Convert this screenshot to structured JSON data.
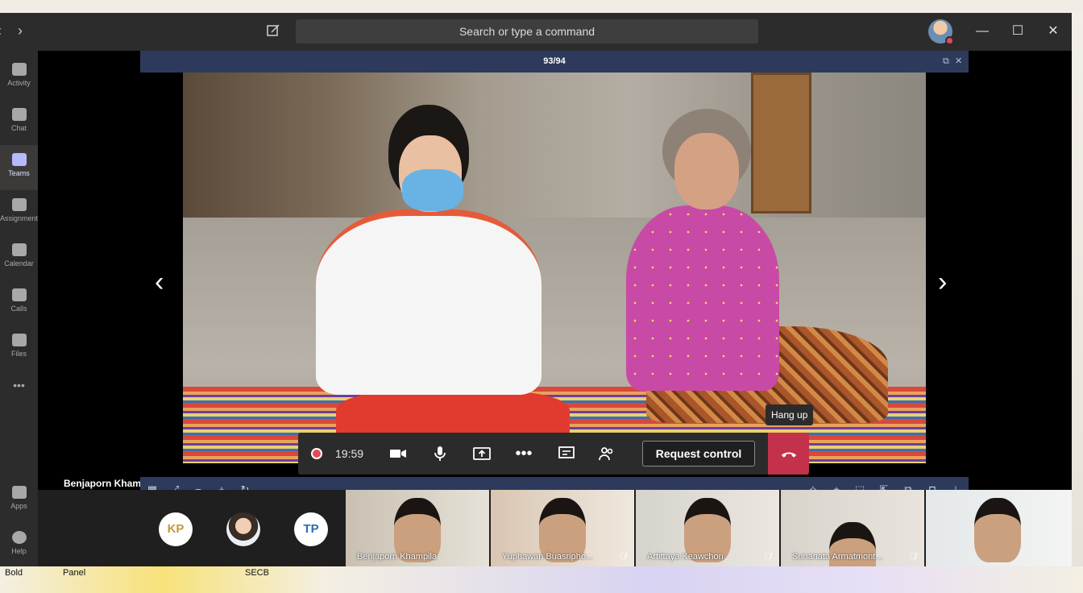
{
  "window": {
    "search_placeholder": "Search or type a command",
    "nav_back": "‹",
    "nav_forward": "›",
    "minimize": "—",
    "maximize": "☐",
    "close": "✕"
  },
  "rail": {
    "items": [
      {
        "label": "Activity"
      },
      {
        "label": "Chat"
      },
      {
        "label": "Teams"
      },
      {
        "label": "Assignments"
      },
      {
        "label": "Calendar"
      },
      {
        "label": "Calls"
      },
      {
        "label": "Files"
      },
      {
        "label": "•••"
      },
      {
        "label": "Apps"
      },
      {
        "label": "Help"
      }
    ]
  },
  "share": {
    "page_counter": "93/94",
    "restore": "⧉",
    "close": "✕"
  },
  "presenter": {
    "name": "Benjaporn Khampila"
  },
  "call": {
    "timer": "19:59",
    "request_control": "Request control",
    "hang_up_tooltip": "Hang up"
  },
  "participants": {
    "avatars": [
      {
        "initials": "KP"
      },
      {
        "initials": "TP"
      }
    ],
    "tiles": [
      {
        "name": "Benjaporn Khampila"
      },
      {
        "name": "Yuphawan Buasripho..."
      },
      {
        "name": "Artittaya Keawchon"
      },
      {
        "name": "Sunanata Armatmont..."
      },
      {
        "name": ""
      }
    ]
  },
  "desktop": {
    "labels": [
      "Bold",
      "Panel",
      "SECB"
    ]
  }
}
